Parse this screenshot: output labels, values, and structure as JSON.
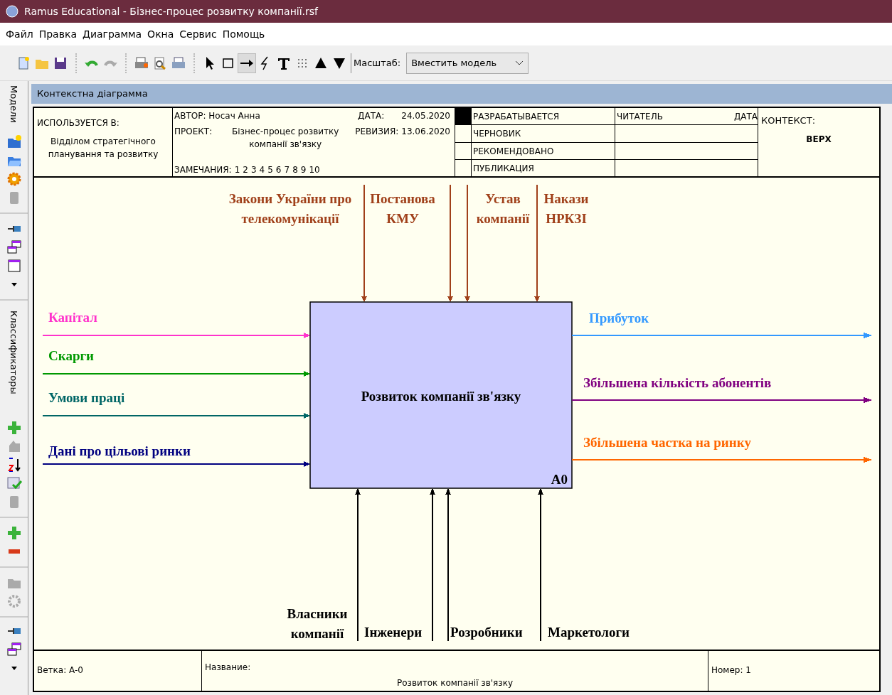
{
  "window": {
    "title": "Ramus Educational - Бізнес-процес розвитку компанії.rsf"
  },
  "menu": [
    "Файл",
    "Правка",
    "Диаграмма",
    "Окна",
    "Сервис",
    "Помощь"
  ],
  "toolbar": {
    "tools": [
      {
        "kind": "new",
        "selected": false
      },
      {
        "kind": "open",
        "selected": false
      },
      {
        "kind": "save",
        "selected": false
      },
      {
        "kind": "sep"
      },
      {
        "kind": "undo",
        "selected": false
      },
      {
        "kind": "redo",
        "selected": false
      },
      {
        "kind": "sep"
      },
      {
        "kind": "print",
        "selected": false
      },
      {
        "kind": "preview",
        "selected": false
      },
      {
        "kind": "printer",
        "selected": false
      },
      {
        "kind": "sep"
      },
      {
        "kind": "pointer",
        "selected": false
      },
      {
        "kind": "rect",
        "selected": false
      },
      {
        "kind": "arrow",
        "selected": true
      },
      {
        "kind": "squiggle",
        "selected": false
      },
      {
        "kind": "text",
        "selected": false
      },
      {
        "kind": "dots",
        "selected": false
      },
      {
        "kind": "up",
        "selected": false
      },
      {
        "kind": "down",
        "selected": false
      }
    ],
    "zoom_label": "Масштаб:",
    "zoom_value": "Вместить модель"
  },
  "sidebar": {
    "tabs": [
      "Модели",
      "Классификаторы"
    ]
  },
  "diagram_tab": "Контекстна діаграмма",
  "header": {
    "used_in_label": "ИСПОЛЬЗУЕТСЯ В:",
    "used_in": "Відділом стратегічного планування та розвитку",
    "author": "АВТОР: Носач Анна",
    "date_label": "ДАТА:",
    "date": "24.05.2020",
    "project_label": "ПРОЕКТ:",
    "project": "Бізнес-процес розвитку компанії зв'язку",
    "revision_label": "РЕВИЗИЯ:",
    "revision": "13.06.2020",
    "notes_label": "ЗАМЕЧАНИЯ:",
    "notes": [
      "1",
      "2",
      "3",
      "4",
      "5",
      "6",
      "7",
      "8",
      "9",
      "10"
    ],
    "statuses": [
      {
        "label": "РАЗРАБАТЫВАЕТСЯ",
        "selected": true
      },
      {
        "label": "ЧЕРНОВИК",
        "selected": false
      },
      {
        "label": "РЕКОМЕНДОВАНО",
        "selected": false
      },
      {
        "label": "ПУБЛИКАЦИЯ",
        "selected": false
      }
    ],
    "reader": "ЧИТАТЕЛЬ",
    "reader_date": "ДАТА",
    "context_label": "КОНТЕКСТ:",
    "context": "ВЕРХ"
  },
  "diagram": {
    "activity": {
      "title": "Розвиток компанії зв'язку",
      "number": "A0"
    },
    "arrows": [
      {
        "kind": "control",
        "lines": [
          "Закони України про",
          "телекомунікації"
        ],
        "color": "#a0401a"
      },
      {
        "kind": "control",
        "lines": [
          "Постанова",
          "КМУ"
        ],
        "color": "#a0401a"
      },
      {
        "kind": "control",
        "lines": [
          "Устав",
          "компанії"
        ],
        "color": "#a0401a"
      },
      {
        "kind": "control",
        "lines": [
          "Накази",
          "НРКЗІ"
        ],
        "color": "#a0401a"
      },
      {
        "kind": "input",
        "lines": [
          "Капітал"
        ],
        "color": "#ff33cc"
      },
      {
        "kind": "input",
        "lines": [
          "Скарги"
        ],
        "color": "#009900"
      },
      {
        "kind": "input",
        "lines": [
          "Умови праці"
        ],
        "color": "#006666"
      },
      {
        "kind": "input",
        "lines": [
          "Дані про цільові ринки"
        ],
        "color": "#000080"
      },
      {
        "kind": "output",
        "lines": [
          "Прибуток"
        ],
        "color": "#3399ff"
      },
      {
        "kind": "output",
        "lines": [
          "Збільшена кількість абонентів"
        ],
        "color": "#800080"
      },
      {
        "kind": "output",
        "lines": [
          "Збільшена частка на ринку"
        ],
        "color": "#ff6600"
      },
      {
        "kind": "mechanism",
        "lines": [
          "Власники",
          "компанії"
        ],
        "color": "#000000"
      },
      {
        "kind": "mechanism",
        "lines": [
          "Інженери"
        ],
        "color": "#000000"
      },
      {
        "kind": "mechanism",
        "lines": [
          "Розробники"
        ],
        "color": "#000000"
      },
      {
        "kind": "mechanism",
        "lines": [
          "Маркетологи"
        ],
        "color": "#000000"
      }
    ]
  },
  "footer": {
    "node": "Ветка:  A-0",
    "name_label": "Название:",
    "name": "Розвиток компанії зв'язку",
    "number": "Номер: 1"
  }
}
